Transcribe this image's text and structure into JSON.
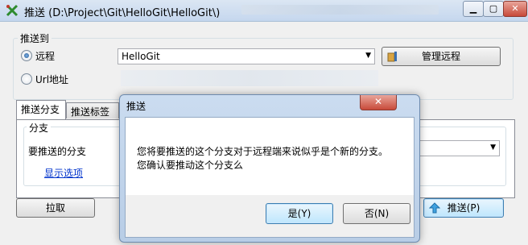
{
  "window": {
    "title": "推送 (D:\\Project\\Git\\HelloGit\\HelloGit\\)",
    "minimize_glyph": "▁",
    "maximize_glyph": "▢",
    "close_glyph": "✕"
  },
  "push_to": {
    "legend": "推送到",
    "remote_label": "远程",
    "remote_value": "HelloGit",
    "manage_remotes_label": "管理远程",
    "url_label": "Url地址"
  },
  "tabs": [
    {
      "label": "推送分支"
    },
    {
      "label": "推送标签"
    }
  ],
  "branch": {
    "legend": "分支",
    "branch_to_push_label": "要推送的分支",
    "show_options_link": "显示选项"
  },
  "footer": {
    "pull_label": "拉取",
    "push_label": "推送(P)"
  },
  "dialog": {
    "title": "推送",
    "close_glyph": "✕",
    "message_line1": "您将要推送的这个分支对于远程端来说似乎是个新的分支。",
    "message_line2": "您确认要推动这个分支么",
    "yes_label": "是(Y)",
    "no_label": "否(N)"
  },
  "icons": {
    "app": "git-app-icon",
    "manage_remotes": "remote-manage-icon",
    "push": "push-arrow-icon"
  },
  "colors": {
    "link": "#0033cc",
    "close_red": "#c84a3a",
    "title_blue": "#c5d7ee"
  }
}
